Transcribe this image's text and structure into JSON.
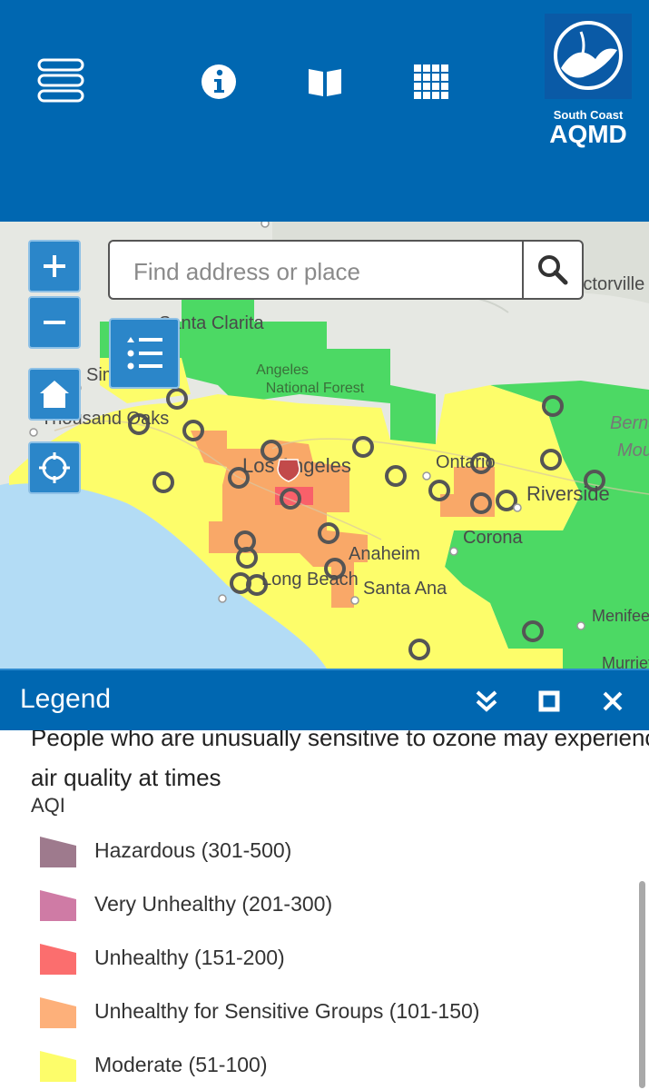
{
  "app": {
    "logo_line1": "South Coast",
    "logo_line2": "AQMD"
  },
  "toolbar": {
    "icons": [
      "menu-icon",
      "info-icon",
      "book-icon",
      "grid-icon"
    ]
  },
  "search": {
    "placeholder": "Find address or place"
  },
  "map": {
    "labels": [
      "Santa Clarita",
      "Angeles",
      "National Forest",
      "Simi",
      "Thousand Oaks",
      "Los Angeles",
      "Ontario",
      "Riverside",
      "Corona",
      "Anaheim",
      "Long Beach",
      "Santa Ana",
      "Victorville",
      "Bernardino",
      "Mountains",
      "Menifee",
      "Murrieta"
    ],
    "colors": {
      "good": "#4cd964",
      "moderate": "#fdfd6a",
      "usg": "#f9a868",
      "unhealthy": "#f9606a",
      "water": "#b3dcf5"
    }
  },
  "legend": {
    "title": "Legend",
    "partial_text_1": "People who are unusually sensitive to ozone may experience poor",
    "partial_text_2": "air quality at times",
    "aqi_label": "AQI",
    "items": [
      {
        "label": "Hazardous (301-500)",
        "color": "#9e7a8d"
      },
      {
        "label": "Very Unhealthy (201-300)",
        "color": "#cf7ba5"
      },
      {
        "label": "Unhealthy (151-200)",
        "color": "#fb6e6e"
      },
      {
        "label": "Unhealthy for Sensitive Groups (101-150)",
        "color": "#fdb07a"
      },
      {
        "label": "Moderate (51-100)",
        "color": "#fdfd6a"
      }
    ]
  }
}
